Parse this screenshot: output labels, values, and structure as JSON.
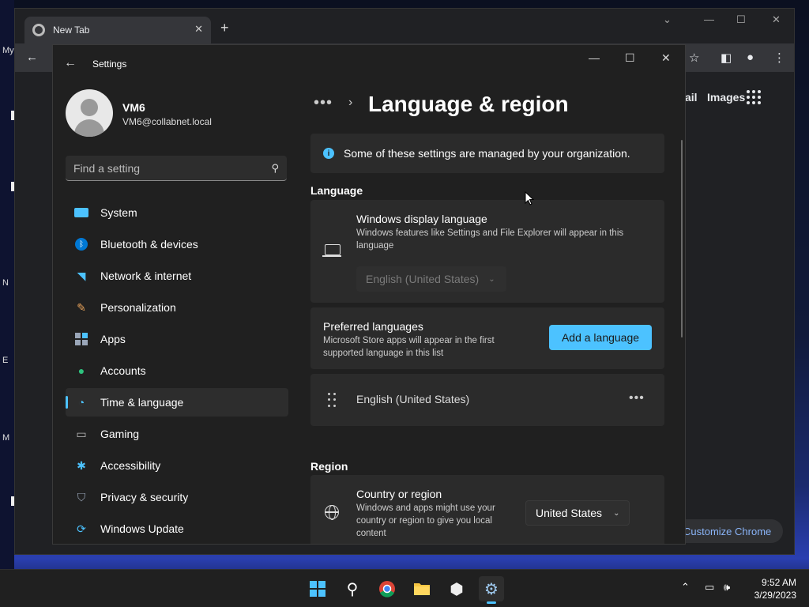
{
  "desktop": {
    "glyphs": [
      "My",
      "N",
      "E",
      "M"
    ]
  },
  "chrome": {
    "tab_title": "New Tab",
    "links": {
      "gmail": "ail",
      "images": "Images"
    },
    "customize_label": "Customize Chrome"
  },
  "settings": {
    "window_title": "Settings",
    "user": {
      "name": "VM6",
      "email": "VM6@collabnet.local"
    },
    "search": {
      "placeholder": "Find a setting"
    },
    "nav": [
      {
        "label": "System",
        "icon": "monitor-icon"
      },
      {
        "label": "Bluetooth & devices",
        "icon": "bluetooth-icon"
      },
      {
        "label": "Network & internet",
        "icon": "wifi-icon"
      },
      {
        "label": "Personalization",
        "icon": "brush-icon"
      },
      {
        "label": "Apps",
        "icon": "apps-icon"
      },
      {
        "label": "Accounts",
        "icon": "person-icon"
      },
      {
        "label": "Time & language",
        "icon": "globe-clock-icon",
        "active": true
      },
      {
        "label": "Gaming",
        "icon": "gamepad-icon"
      },
      {
        "label": "Accessibility",
        "icon": "accessibility-icon"
      },
      {
        "label": "Privacy & security",
        "icon": "shield-icon"
      },
      {
        "label": "Windows Update",
        "icon": "update-icon"
      }
    ],
    "page": {
      "breadcrumb_more": "•••",
      "title": "Language & region",
      "info": "Some of these settings are managed by your organization.",
      "language_header": "Language",
      "display_language": {
        "title": "Windows display language",
        "desc": "Windows features like Settings and File Explorer will appear in this language",
        "value": "English (United States)"
      },
      "preferred": {
        "title": "Preferred languages",
        "desc": "Microsoft Store apps will appear in the first supported language in this list",
        "button": "Add a language"
      },
      "installed_language": "English (United States)",
      "region_header": "Region",
      "country": {
        "title": "Country or region",
        "desc": "Windows and apps might use your country or region to give you local content",
        "value": "United States"
      }
    }
  },
  "taskbar": {
    "time": "9:52 AM",
    "date": "3/29/2023"
  },
  "colors": {
    "accent": "#4cc2ff",
    "window_bg": "#202020",
    "card_bg": "#2b2b2b"
  }
}
